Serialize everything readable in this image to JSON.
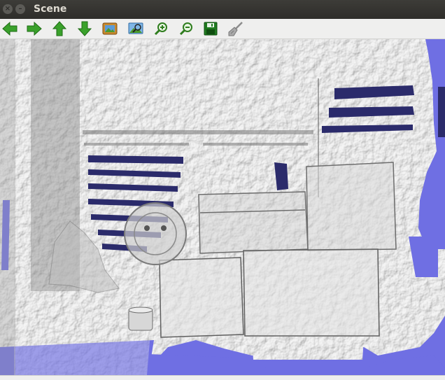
{
  "window": {
    "title": "Scene",
    "close_glyph": "×",
    "minimize_glyph": "–"
  },
  "toolbar": {
    "buttons": [
      {
        "name": "back-arrow-icon"
      },
      {
        "name": "forward-arrow-icon"
      },
      {
        "name": "up-arrow-icon"
      },
      {
        "name": "down-arrow-icon"
      },
      {
        "name": "picture-icon"
      },
      {
        "name": "zoom-to-fit-icon"
      },
      {
        "name": "zoom-in-icon"
      },
      {
        "name": "zoom-out-icon"
      },
      {
        "name": "save-icon"
      },
      {
        "name": "clear-brush-icon"
      }
    ]
  },
  "colors": {
    "mesh": "#bcbcbc",
    "background_blue": "#6f6fe3",
    "arrow_green": "#3aa12b",
    "save_green": "#1f7a1f"
  }
}
